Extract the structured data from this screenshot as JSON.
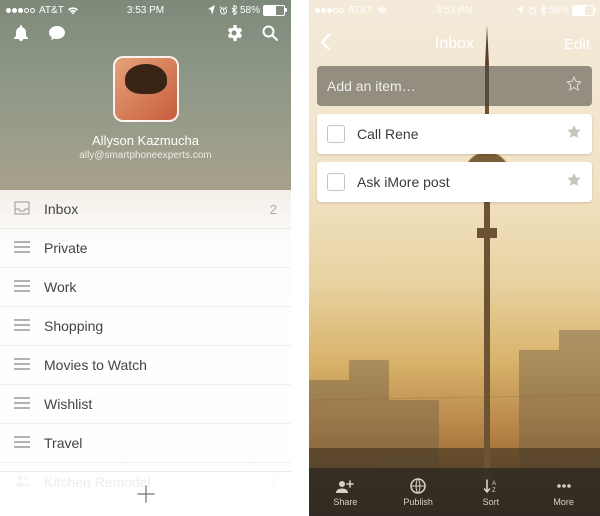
{
  "status": {
    "carrier": "AT&T",
    "time": "3:53 PM",
    "battery_pct": "58%"
  },
  "left": {
    "profile": {
      "name": "Allyson Kazmucha",
      "email": "ally@smartphoneexperts.com"
    },
    "lists": [
      {
        "icon": "inbox",
        "label": "Inbox",
        "count": "2"
      },
      {
        "icon": "list",
        "label": "Private",
        "count": ""
      },
      {
        "icon": "list",
        "label": "Work",
        "count": ""
      },
      {
        "icon": "list",
        "label": "Shopping",
        "count": ""
      },
      {
        "icon": "list",
        "label": "Movies to Watch",
        "count": ""
      },
      {
        "icon": "list",
        "label": "Wishlist",
        "count": ""
      },
      {
        "icon": "list",
        "label": "Travel",
        "count": ""
      },
      {
        "icon": "people",
        "label": "Kitchen Remodel",
        "count": "2"
      }
    ]
  },
  "right": {
    "title": "Inbox",
    "edit": "Edit",
    "add_placeholder": "Add an item…",
    "items": [
      {
        "label": "Call Rene"
      },
      {
        "label": "Ask iMore post"
      }
    ],
    "tabs": [
      {
        "icon": "share",
        "label": "Share"
      },
      {
        "icon": "globe",
        "label": "Publish"
      },
      {
        "icon": "sort",
        "label": "Sort"
      },
      {
        "icon": "more",
        "label": "More"
      }
    ]
  }
}
